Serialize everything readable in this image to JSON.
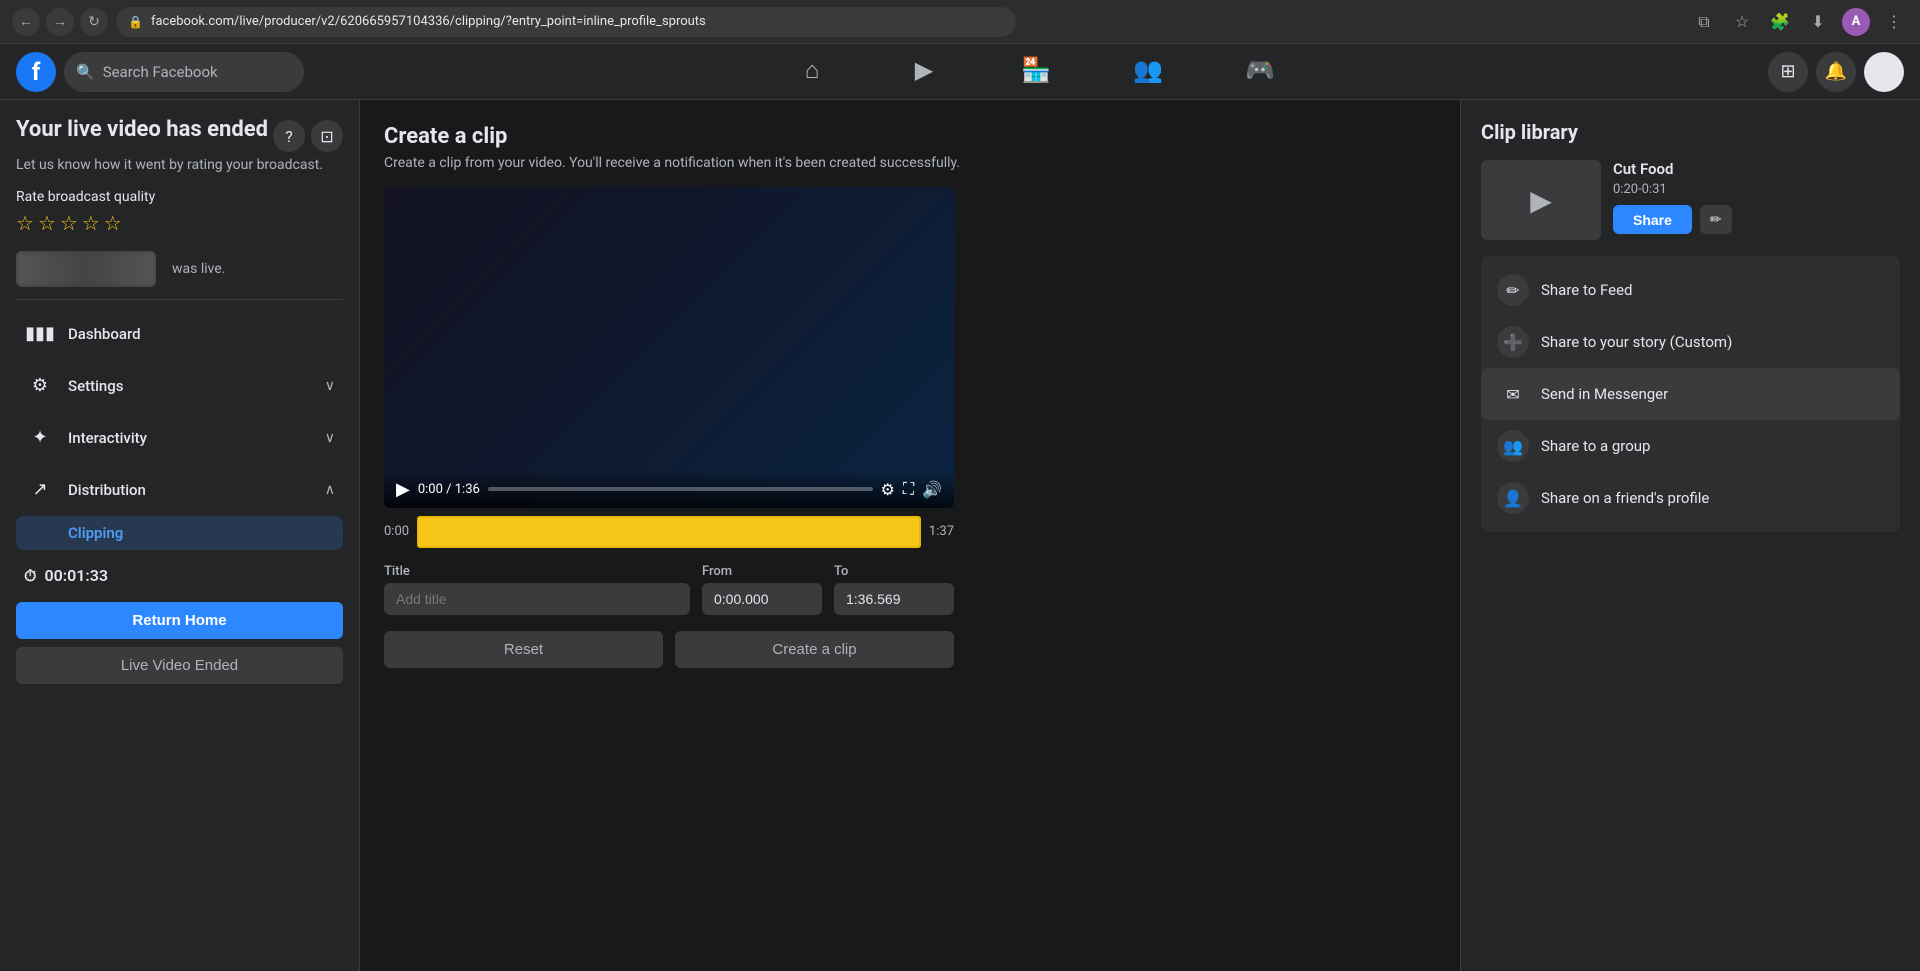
{
  "browser": {
    "url": "facebook.com/live/producer/v2/620665957104336/clipping/?entry_point=inline_profile_sprouts",
    "back_tooltip": "Back",
    "forward_tooltip": "Forward",
    "refresh_tooltip": "Refresh",
    "profile_initial": "A"
  },
  "header": {
    "search_placeholder": "Search Facebook",
    "logo_letter": "f",
    "nav_items": [
      {
        "name": "home-icon",
        "symbol": "⌂"
      },
      {
        "name": "video-icon",
        "symbol": "▶"
      },
      {
        "name": "store-icon",
        "symbol": "🏪"
      },
      {
        "name": "people-icon",
        "symbol": "👥"
      },
      {
        "name": "gaming-icon",
        "symbol": "🎮"
      }
    ],
    "grid_icon": "⊞",
    "bell_icon": "🔔"
  },
  "sidebar": {
    "title": "Your live video has ended",
    "subtitle": "Let us know how it went by rating your broadcast.",
    "rate_label": "Rate broadcast quality",
    "stars": [
      "★",
      "★",
      "★",
      "★",
      "★"
    ],
    "was_live_text": "was live.",
    "help_icon": "?",
    "share_icon": "⊡",
    "nav_items": [
      {
        "id": "dashboard",
        "label": "Dashboard",
        "icon": "▮▮▮"
      },
      {
        "id": "settings",
        "label": "Settings",
        "icon": "⚙",
        "has_chevron": true,
        "chevron": "∨"
      },
      {
        "id": "interactivity",
        "label": "Interactivity",
        "icon": "✦",
        "has_chevron": true,
        "chevron": "∨"
      },
      {
        "id": "distribution",
        "label": "Distribution",
        "icon": "↗",
        "has_chevron": true,
        "chevron": "∧",
        "expanded": true
      }
    ],
    "sub_items": [
      {
        "id": "clipping",
        "label": "Clipping",
        "active": true
      }
    ],
    "timer_icon": "⏱",
    "timer_value": "00:01:33",
    "return_home": "Return Home",
    "live_ended": "Live Video Ended"
  },
  "main": {
    "title": "Create a clip",
    "description": "Create a clip from your video. You'll receive a notification when it's been created successfully.",
    "video": {
      "current_time": "0:00",
      "duration": "1:36",
      "play_icon": "▶",
      "settings_icon": "⚙",
      "fullscreen_icon": "⛶",
      "volume_icon": "🔊"
    },
    "range": {
      "start_time": "0:00",
      "end_time": "1:37"
    },
    "fields": {
      "title_label": "Title",
      "title_placeholder": "Add title",
      "from_label": "From",
      "from_value": "0:00.000",
      "to_label": "To",
      "to_value": "1:36.569"
    },
    "buttons": {
      "reset": "Reset",
      "create_clip": "Create a clip"
    }
  },
  "clip_library": {
    "title": "Clip library",
    "clips": [
      {
        "name": "Cut Food",
        "duration": "0:20-0:31",
        "thumbnail_icon": "▶"
      }
    ],
    "share_button": "Share",
    "edit_icon": "✏",
    "share_options": [
      {
        "id": "feed",
        "label": "Share to Feed",
        "icon": "✏"
      },
      {
        "id": "story",
        "label": "Share to your story (Custom)",
        "icon": "➕"
      },
      {
        "id": "messenger",
        "label": "Send in Messenger",
        "icon": "✉",
        "active": true
      },
      {
        "id": "group",
        "label": "Share to a group",
        "icon": "👥"
      },
      {
        "id": "friends-profile",
        "label": "Share on a friend's profile",
        "icon": "👤"
      }
    ]
  }
}
